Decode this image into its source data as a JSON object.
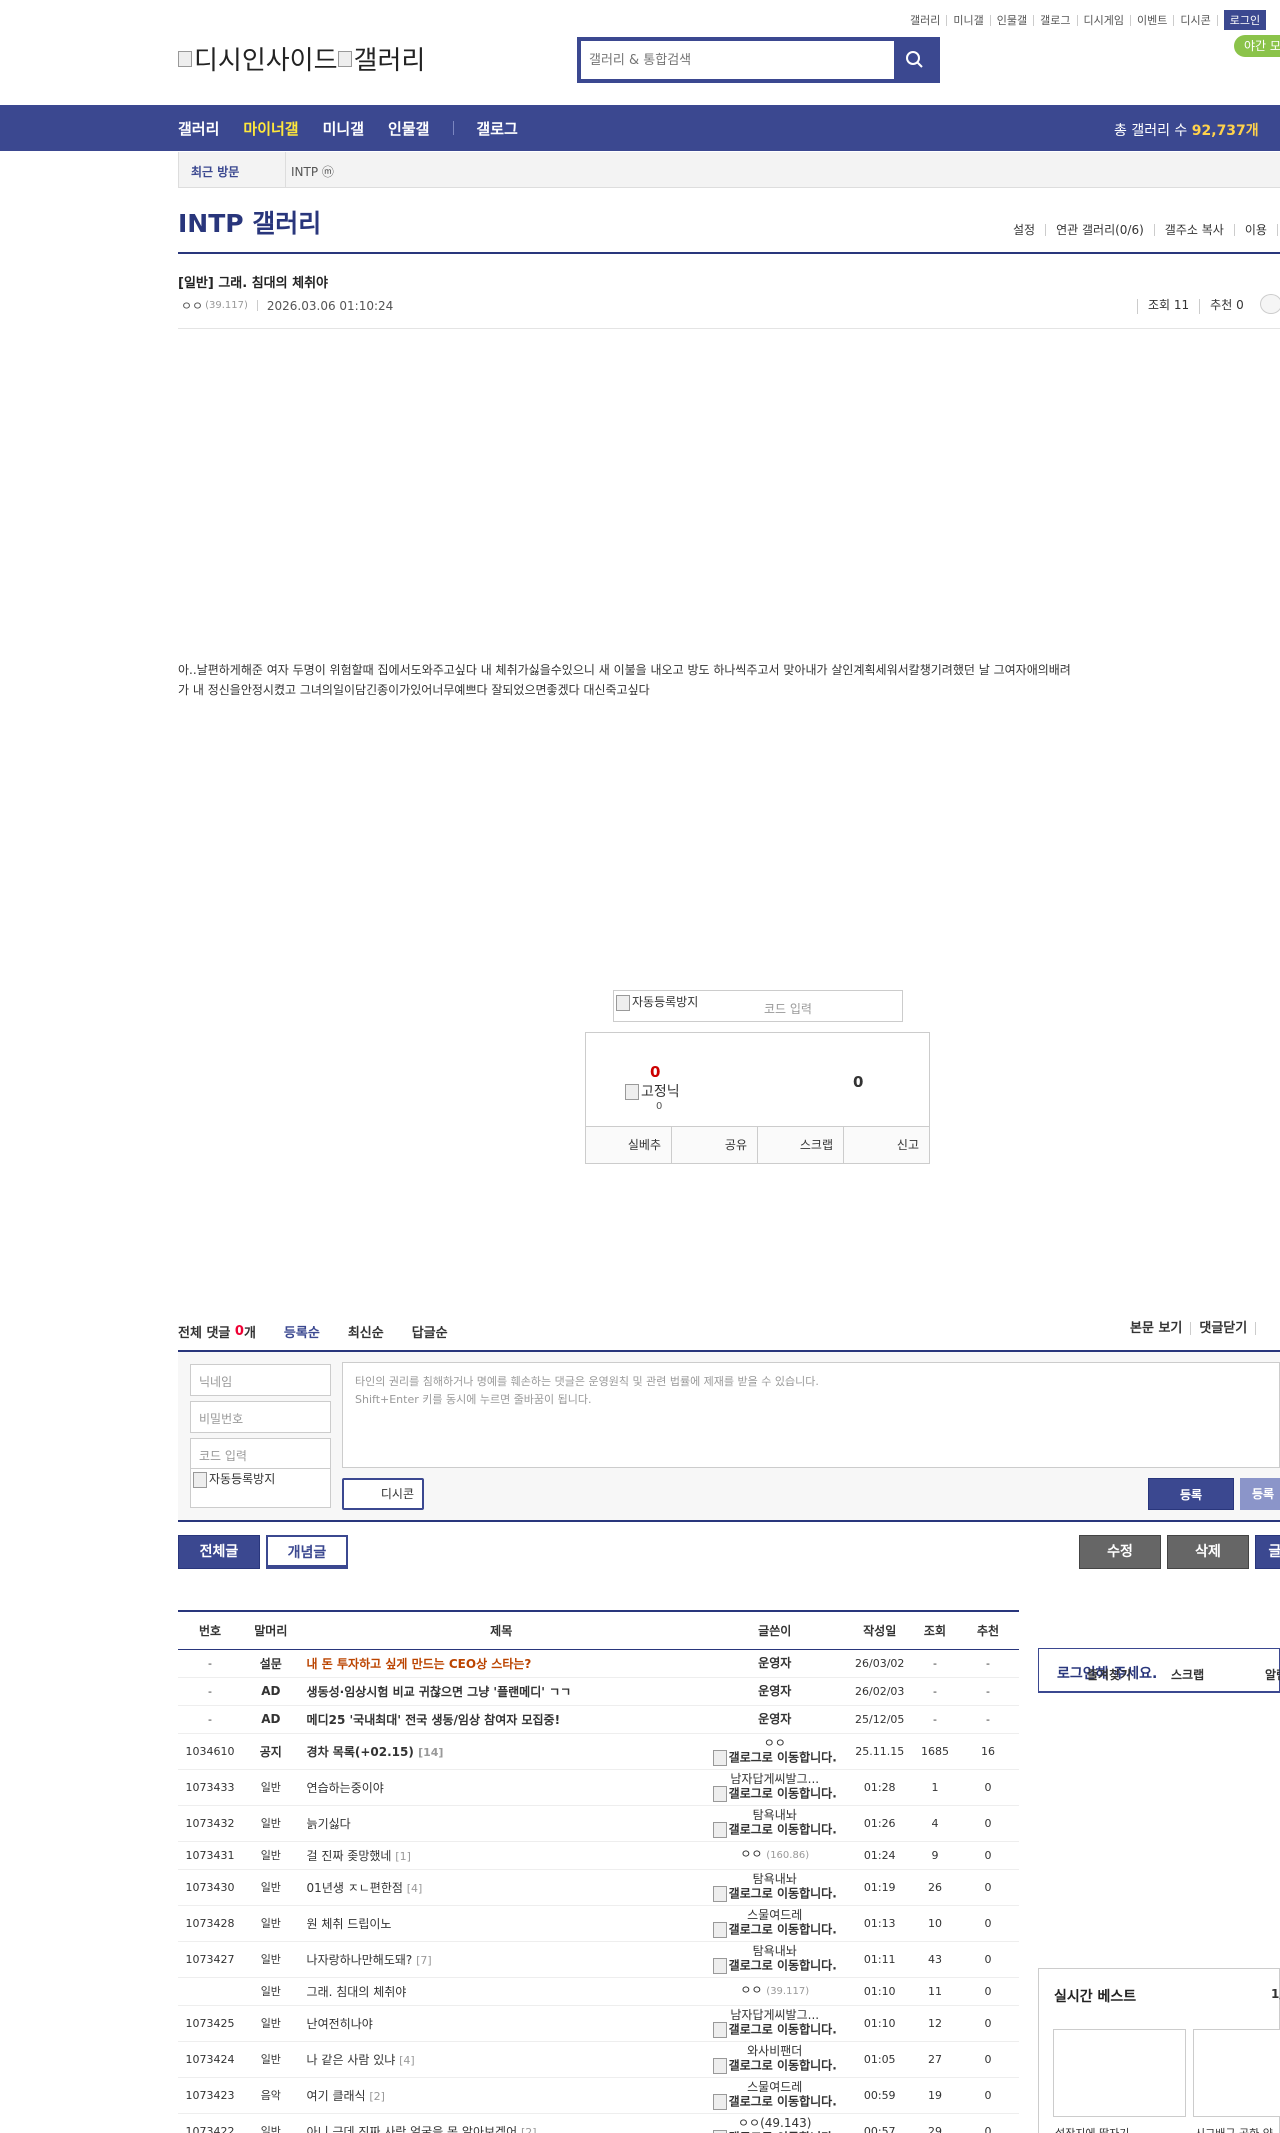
{
  "top_links": [
    "갤러리",
    "미니갤",
    "인물갤",
    "갤로그",
    "디시게임",
    "이벤트",
    "디시콘"
  ],
  "login_label": "로그인",
  "night_mode": "야간 모",
  "logo": {
    "alt1": "디시인사이드",
    "alt2": "갤러리"
  },
  "search": {
    "placeholder": "갤러리 & 통합검색"
  },
  "nav": {
    "items": [
      "갤러리",
      "마이너갤",
      "미니갤",
      "인물갤"
    ],
    "gallog": "갤로그",
    "count_label": "총 갤러리 수",
    "count_value": "92,737개"
  },
  "recent": {
    "label": "최근 방문",
    "item": "INTP ⓜ"
  },
  "gallery": {
    "title": "INTP 갤러리",
    "options": [
      "설정",
      "연관 갤러리(0/6)",
      "갤주소 복사",
      "이용"
    ]
  },
  "post": {
    "title": "[일반] 그래. 침대의 체취야",
    "author": "ㅇㅇ",
    "author_ip": "(39.117)",
    "date": "2026.03.06 01:10:24",
    "views": "조회 11",
    "recommends": "추천 0",
    "body": "아..날편하게해준 여자 두명이 위험할때 집에서도와주고싶다 내 체취가싫을수있으니 새 이불을 내오고 방도 하나씩주고서 맞아내가 살인계획세워서칼챙기려했던 날 그여자애의배려가 내 정신을안정시켰고 그녀의일이담긴종이가있어너무예쁘다 잘되었으면좋겠다 대신죽고싶다"
  },
  "captcha": {
    "img_alt": "자동등록방지",
    "input_placeholder": "코드 입력"
  },
  "recommend_box": {
    "up_count": "0",
    "fixed_alt": "고정닉",
    "fixed_count": "0",
    "down_count": "0",
    "buttons": [
      "실베추",
      "공유",
      "스크랩",
      "신고"
    ]
  },
  "comments": {
    "total_label": "전체 댓글",
    "total_count": "0",
    "total_suffix": "개",
    "sorts": [
      "등록순",
      "최신순",
      "답글순"
    ],
    "right_links": [
      "본문 보기",
      "댓글닫기"
    ],
    "nick_placeholder": "닉네임",
    "pw_placeholder": "비밀번호",
    "code_placeholder": "코드 입력",
    "captcha_alt": "자동등록방지",
    "text_line1": "타인의 권리를 침해하거나 명예를 훼손하는 댓글은 운영원칙 및 관련 법률에 제재를 받을 수 있습니다.",
    "text_line2": "Shift+Enter 키를 동시에 누르면 줄바꿈이 됩니다.",
    "dccon": "디시콘",
    "register": "등록",
    "register2": "등록"
  },
  "list_buttons": {
    "all": "전체글",
    "concept": "개념글",
    "edit": "수정",
    "delete": "삭제",
    "write": "글"
  },
  "table": {
    "headers": [
      "번호",
      "말머리",
      "제목",
      "글쓴이",
      "작성일",
      "조회",
      "추천"
    ],
    "go_text": "갤로그로 이동합니다.",
    "rows": [
      {
        "no": "-",
        "head": "설문",
        "subj": "내 돈 투자하고 싶게 만드는 CEO상 스타는?",
        "reply": "",
        "writer": "운영자",
        "ip": "",
        "go": false,
        "date": "26/03/02",
        "views": "-",
        "rec": "-"
      },
      {
        "no": "-",
        "head": "AD",
        "subj": "생동성·임상시험 비교 귀찮으면 그냥 '플랜메디' ㄱㄱ",
        "reply": "",
        "writer": "운영자",
        "ip": "",
        "go": false,
        "date": "26/02/03",
        "views": "-",
        "rec": "-"
      },
      {
        "no": "-",
        "head": "AD",
        "subj": "메디25 '국내최대' 전국 생동/임상 참여자 모집중!",
        "reply": "",
        "writer": "운영자",
        "ip": "",
        "go": false,
        "date": "25/12/05",
        "views": "-",
        "rec": "-"
      },
      {
        "no": "1034610",
        "head": "공지",
        "subj": "경차 목록(+02.15)",
        "reply": "[14]",
        "writer": "ㅇㅇ",
        "ip": "",
        "go": true,
        "date": "25.11.15",
        "views": "1685",
        "rec": "16"
      },
      {
        "no": "1073433",
        "head": "일반",
        "subj": "연습하는중이야",
        "reply": "",
        "writer": "남자답게씨발그...",
        "ip": "",
        "go": true,
        "date": "01:28",
        "views": "1",
        "rec": "0"
      },
      {
        "no": "1073432",
        "head": "일반",
        "subj": "늙기싫다",
        "reply": "",
        "writer": "탐욕내놔",
        "ip": "",
        "go": true,
        "date": "01:26",
        "views": "4",
        "rec": "0"
      },
      {
        "no": "1073431",
        "head": "일반",
        "subj": "걸 진짜 좆망했네",
        "reply": "[1]",
        "writer": "ㅇㅇ",
        "ip": "(160.86)",
        "go": false,
        "date": "01:24",
        "views": "9",
        "rec": "0"
      },
      {
        "no": "1073430",
        "head": "일반",
        "subj": "01년생 ㅈㄴ편한점",
        "reply": "[4]",
        "writer": "탐욕내놔",
        "ip": "",
        "go": true,
        "date": "01:19",
        "views": "26",
        "rec": "0"
      },
      {
        "no": "1073428",
        "head": "일반",
        "subj": "원 체취 드립이노",
        "reply": "",
        "writer": "스물여드레",
        "ip": "",
        "go": true,
        "date": "01:13",
        "views": "10",
        "rec": "0"
      },
      {
        "no": "1073427",
        "head": "일반",
        "subj": "나자랑하나만해도돼?",
        "reply": "[7]",
        "writer": "탐욕내놔",
        "ip": "",
        "go": true,
        "date": "01:11",
        "views": "43",
        "rec": "0"
      },
      {
        "no": "",
        "head": "일반",
        "subj": "그래. 침대의 체취야",
        "reply": "",
        "writer": "ㅇㅇ",
        "ip": "(39.117)",
        "go": false,
        "date": "01:10",
        "views": "11",
        "rec": "0"
      },
      {
        "no": "1073425",
        "head": "일반",
        "subj": "난여전히나야",
        "reply": "",
        "writer": "남자답게씨발그...",
        "ip": "",
        "go": true,
        "date": "01:10",
        "views": "12",
        "rec": "0"
      },
      {
        "no": "1073424",
        "head": "일반",
        "subj": "나 같은 사람 있냐",
        "reply": "[4]",
        "writer": "와사비팬더",
        "ip": "",
        "go": true,
        "date": "01:05",
        "views": "27",
        "rec": "0"
      },
      {
        "no": "1073423",
        "head": "음악",
        "subj": "여기 클래식",
        "reply": "[2]",
        "writer": "스물여드레",
        "ip": "",
        "go": true,
        "date": "00:59",
        "views": "19",
        "rec": "0"
      },
      {
        "no": "1073422",
        "head": "일반",
        "subj": "아니 근데 진짜 사람 얼굴을 못 알아보겠어",
        "reply": "[2]",
        "writer": "ㅇㅇ(49.143)",
        "ip": "",
        "go": true,
        "date": "00:57",
        "views": "29",
        "rec": "0"
      }
    ]
  },
  "sidebar": {
    "login_title": "로그인해 주세요.",
    "links": [
      "즐겨찾기",
      "스크랩",
      "알림"
    ],
    "best_title": "실시간 베스트",
    "best_page": "1/",
    "best_captions": [
      "설작지에 딸자기",
      "시그배구 공화 약"
    ]
  }
}
